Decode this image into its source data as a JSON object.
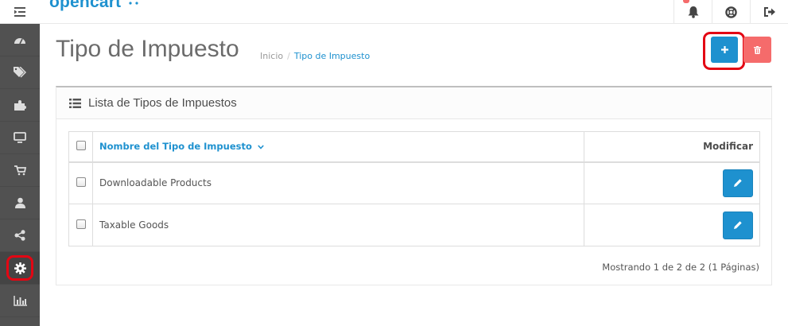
{
  "header": {
    "logo_text": "opencart",
    "notification_count_visible": true
  },
  "sidebar": {
    "items": [
      {
        "icon": "dashboard-icon"
      },
      {
        "icon": "tags-icon"
      },
      {
        "icon": "puzzle-icon"
      },
      {
        "icon": "desktop-icon"
      },
      {
        "icon": "shopping-cart-icon"
      },
      {
        "icon": "user-icon"
      },
      {
        "icon": "share-icon"
      },
      {
        "icon": "cog-icon",
        "active": true
      },
      {
        "icon": "bar-chart-icon"
      }
    ]
  },
  "page": {
    "title": "Tipo de Impuesto",
    "breadcrumb": [
      "Inicio",
      "Tipo de Impuesto"
    ]
  },
  "panel": {
    "title": "Lista de Tipos de Impuestos",
    "columns": {
      "name": "Nombre del Tipo de Impuesto",
      "action": "Modificar"
    },
    "rows": [
      {
        "name": "Downloadable Products"
      },
      {
        "name": "Taxable Goods"
      }
    ],
    "pagination_text": "Mostrando 1 de 2 de 2 (1 Páginas)"
  },
  "colors": {
    "primary": "#1e91cf",
    "danger": "#f56b6b",
    "sidebar": "#515151",
    "highlight_ring": "#e30613"
  }
}
